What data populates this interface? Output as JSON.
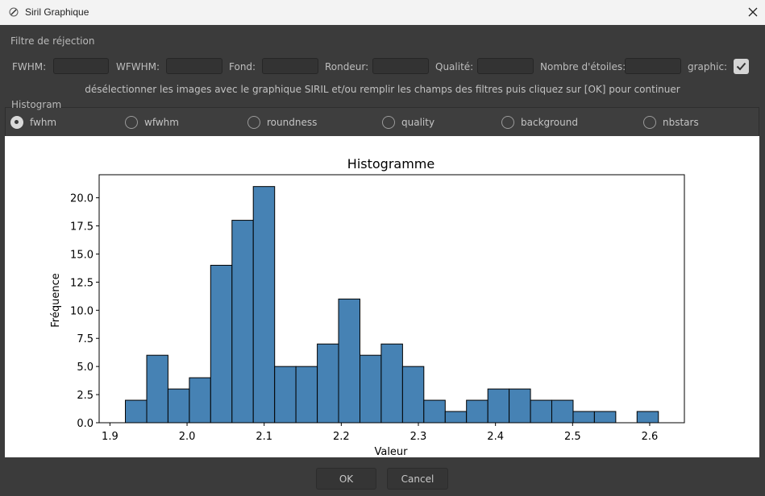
{
  "window": {
    "title": "Siril Graphique",
    "app_icon": "siril-icon",
    "close_icon": "close-icon"
  },
  "rejection": {
    "frame_label": "Filtre de réjection",
    "fields": [
      {
        "label": "FWHM:",
        "value": ""
      },
      {
        "label": "WFWHM:",
        "value": ""
      },
      {
        "label": "Fond:",
        "value": ""
      },
      {
        "label": "Rondeur:",
        "value": ""
      },
      {
        "label": "Qualité:",
        "value": ""
      },
      {
        "label": "Nombre d'étoiles:",
        "value": ""
      }
    ],
    "graphic_label": "graphic:",
    "graphic_checked": true,
    "hint": "désélectionner les images avec le graphique SIRIL et/ou remplir les champs des filtres puis cliquez sur [OK] pour continuer"
  },
  "histogram": {
    "frame_label": "Histogram",
    "selected": "fwhm",
    "options": [
      "fwhm",
      "wfwhm",
      "roundness",
      "quality",
      "background",
      "nbstars"
    ]
  },
  "chart_data": {
    "type": "bar",
    "title": "Histogramme",
    "xlabel": "Valeur",
    "ylabel": "Fréquence",
    "bins": [
      [
        1.92,
        1.9477,
        2
      ],
      [
        1.9477,
        1.9753,
        6
      ],
      [
        1.9753,
        2.003,
        3
      ],
      [
        2.003,
        2.0306,
        4
      ],
      [
        2.0306,
        2.0583,
        14
      ],
      [
        2.0583,
        2.0859,
        18
      ],
      [
        2.0859,
        2.1136,
        21
      ],
      [
        2.1136,
        2.1412,
        5
      ],
      [
        2.1412,
        2.1689,
        5
      ],
      [
        2.1689,
        2.1965,
        7
      ],
      [
        2.1965,
        2.2242,
        11
      ],
      [
        2.2242,
        2.2518,
        6
      ],
      [
        2.2518,
        2.2795,
        7
      ],
      [
        2.2795,
        2.3071,
        5
      ],
      [
        2.3071,
        2.3348,
        2
      ],
      [
        2.3348,
        2.3624,
        1
      ],
      [
        2.3624,
        2.3901,
        2
      ],
      [
        2.3901,
        2.4177,
        3
      ],
      [
        2.4177,
        2.4454,
        3
      ],
      [
        2.4454,
        2.473,
        2
      ],
      [
        2.473,
        2.5007,
        2
      ],
      [
        2.5007,
        2.5283,
        1
      ],
      [
        2.5283,
        2.556,
        1
      ],
      [
        2.556,
        2.5836,
        0
      ],
      [
        2.5836,
        2.6113,
        1
      ]
    ],
    "xlim": [
      1.886,
      2.645
    ],
    "ylim": [
      0,
      22.05
    ],
    "xticks": [
      "1.9",
      "2.0",
      "2.1",
      "2.2",
      "2.3",
      "2.4",
      "2.5",
      "2.6"
    ],
    "yticks": [
      "0.0",
      "2.5",
      "5.0",
      "7.5",
      "10.0",
      "12.5",
      "15.0",
      "17.5",
      "20.0"
    ],
    "bar_color": "#4682b4",
    "grid": false
  },
  "buttons": {
    "ok": "OK",
    "cancel": "Cancel"
  }
}
